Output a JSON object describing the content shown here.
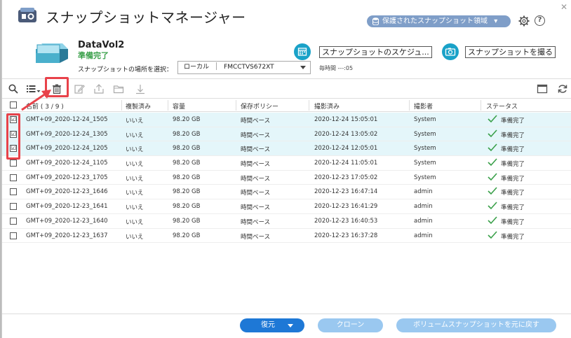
{
  "app": {
    "title": "スナップショットマネージャー",
    "protected_area_label": "保護されたスナップショット領域"
  },
  "volume": {
    "name": "DataVol2",
    "status": "準備完了",
    "location_label": "スナップショットの場所を選択：",
    "location_type": "ローカル",
    "location_device": "FMCCTVS672XT",
    "time_label": "毎時間 ---:05"
  },
  "actions": {
    "schedule_label": "スナップショットのスケジュ...",
    "take_label": "スナップショットを撮る"
  },
  "table": {
    "headers": {
      "name": "名前 ( 3 / 9 )",
      "replicated": "複製済み",
      "capacity": "容量",
      "policy": "保存ポリシー",
      "taken": "撮影済み",
      "taken_by": "撮影者",
      "status": "ステータス"
    },
    "rows": [
      {
        "name": "GMT+09_2020-12-24_1505",
        "replicated": "いいえ",
        "capacity": "98.20 GB",
        "policy": "時間ベース",
        "taken": "2020-12-24 15:05:01",
        "taken_by": "System",
        "status": "準備完了",
        "checked": "☑"
      },
      {
        "name": "GMT+09_2020-12-24_1305",
        "replicated": "いいえ",
        "capacity": "98.20 GB",
        "policy": "時間ベース",
        "taken": "2020-12-24 13:05:02",
        "taken_by": "System",
        "status": "準備完了",
        "checked": "☑"
      },
      {
        "name": "GMT+09_2020-12-24_1205",
        "replicated": "いいえ",
        "capacity": "98.20 GB",
        "policy": "時間ベース",
        "taken": "2020-12-24 12:05:01",
        "taken_by": "System",
        "status": "準備完了",
        "checked": "☑"
      },
      {
        "name": "GMT+09_2020-12-24_1105",
        "replicated": "いいえ",
        "capacity": "98.20 GB",
        "policy": "時間ベース",
        "taken": "2020-12-24 11:05:01",
        "taken_by": "System",
        "status": "準備完了",
        "checked": ""
      },
      {
        "name": "GMT+09_2020-12-23_1705",
        "replicated": "いいえ",
        "capacity": "98.20 GB",
        "policy": "時間ベース",
        "taken": "2020-12-23 17:05:02",
        "taken_by": "System",
        "status": "準備完了",
        "checked": ""
      },
      {
        "name": "GMT+09_2020-12-23_1646",
        "replicated": "いいえ",
        "capacity": "98.20 GB",
        "policy": "時間ベース",
        "taken": "2020-12-23 16:47:14",
        "taken_by": "admin",
        "status": "準備完了",
        "checked": ""
      },
      {
        "name": "GMT+09_2020-12-23_1641",
        "replicated": "いいえ",
        "capacity": "98.20 GB",
        "policy": "時間ベース",
        "taken": "2020-12-23 16:41:29",
        "taken_by": "admin",
        "status": "準備完了",
        "checked": ""
      },
      {
        "name": "GMT+09_2020-12-23_1640",
        "replicated": "いいえ",
        "capacity": "98.20 GB",
        "policy": "時間ベース",
        "taken": "2020-12-23 16:40:53",
        "taken_by": "admin",
        "status": "準備完了",
        "checked": ""
      },
      {
        "name": "GMT+09_2020-12-23_1637",
        "replicated": "いいえ",
        "capacity": "98.20 GB",
        "policy": "時間ベース",
        "taken": "2020-12-23 16:37:28",
        "taken_by": "admin",
        "status": "準備完了",
        "checked": ""
      }
    ]
  },
  "footer": {
    "restore_label": "復元",
    "clone_label": "クローン",
    "revert_label": "ボリュームスナップショットを元に戻す"
  },
  "colors": {
    "accent": "#1aa2c8",
    "primary_button": "#1e78d6",
    "disabled_button": "#9ac8f0",
    "ready_green": "#3aa04a",
    "highlight_red": "#e8424a",
    "selected_row": "#e4f6fa"
  },
  "icons": [
    "app-icon",
    "database-icon",
    "gear-icon",
    "help-icon",
    "close-icon",
    "volume-icon",
    "calendar-icon",
    "camera-icon",
    "search-icon",
    "list-view-icon",
    "trash-icon",
    "edit-icon",
    "upload-icon",
    "folder-icon",
    "download-icon",
    "window-icon",
    "refresh-icon",
    "check-icon"
  ]
}
